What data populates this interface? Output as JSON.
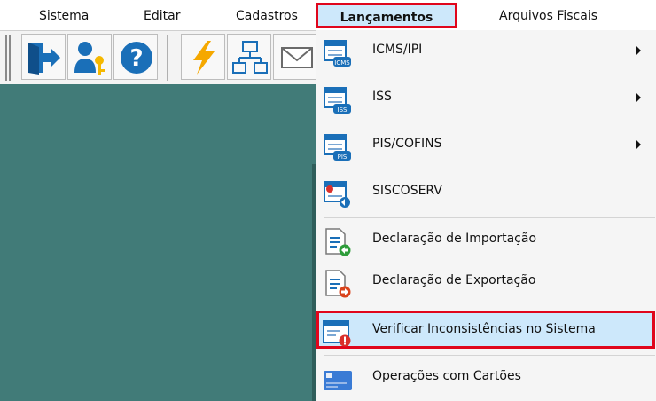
{
  "menubar": {
    "items": [
      {
        "label": "Sistema"
      },
      {
        "label": "Editar"
      },
      {
        "label": "Cadastros"
      },
      {
        "label": "Lançamentos"
      },
      {
        "label": "Arquivos Fiscais"
      }
    ]
  },
  "toolbar": {
    "buttons": [
      {
        "icon": "exit-icon"
      },
      {
        "icon": "user-key-icon"
      },
      {
        "icon": "help-icon"
      },
      {
        "icon": "lightning-icon"
      },
      {
        "icon": "flowchart-icon"
      },
      {
        "icon": "envelope-icon"
      }
    ]
  },
  "dropdown": {
    "items": [
      {
        "label": "ICMS/IPI",
        "icon": "icms-icon",
        "submenu": true
      },
      {
        "label": "ISS",
        "icon": "iss-icon",
        "submenu": true
      },
      {
        "label": "PIS/COFINS",
        "icon": "pis-icon",
        "submenu": true
      },
      {
        "label": "SISCOSERV",
        "icon": "siscoserv-icon",
        "submenu": false
      },
      {
        "label": "Declaração de Importação",
        "icon": "import-declaration-icon",
        "submenu": false
      },
      {
        "label": "Declaração de Exportação",
        "icon": "export-declaration-icon",
        "submenu": false
      },
      {
        "label": "Verificar Inconsistências no Sistema",
        "icon": "verify-inconsistencies-icon",
        "submenu": false
      },
      {
        "label": "Operações com Cartões",
        "icon": "card-icon",
        "submenu": false
      }
    ]
  },
  "colors": {
    "highlight_border": "#e0061c",
    "highlight_fill": "#cde8fb",
    "workspace": "#417b78"
  }
}
